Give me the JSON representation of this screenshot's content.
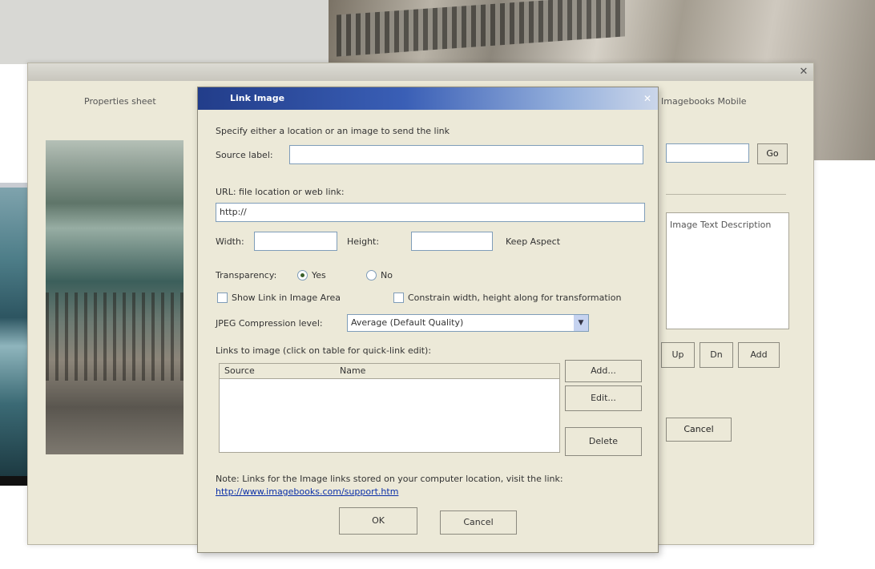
{
  "main_window": {
    "tabs": [
      "Properties sheet"
    ],
    "tab_right": "Imagebooks Mobile",
    "go_button": "Go",
    "list_item": "Image Text Description",
    "buttons": [
      "Up",
      "Dn",
      "Add"
    ],
    "cancel": "Cancel"
  },
  "dialog": {
    "title": "Link Image",
    "close_glyph": "✕",
    "instructions": "Specify either a location or an image to send the link",
    "source_label": "Source label:",
    "source_value": "",
    "url_section_label": "URL: file location or web link:",
    "url_value": "http://",
    "width_label": "Width:",
    "width_value": "",
    "height_label": "Height:",
    "height_value": "",
    "units_label": "Keep Aspect",
    "scale_label": "Transparency:",
    "scale_on": "Yes",
    "scale_off": "No",
    "check1": "Show Link in Image Area",
    "check2": "Constrain width, height along for transformation",
    "quality_label": "JPEG Compression level:",
    "quality_value": "Average (Default Quality)",
    "table_label": "Links to image (click on table for quick-link edit):",
    "table_headers": [
      "Source",
      "Name"
    ],
    "side_buttons": [
      "Add...",
      "Edit...",
      "Delete"
    ],
    "footer_text": "Note: Links for the Image links stored on your computer location, visit the link:",
    "footer_link": "http://www.imagebooks.com/support.htm",
    "ok": "OK",
    "cancel": "Cancel"
  },
  "colors": {
    "dialog_bg": "#ece9d8",
    "title_bar_start": "#223d8a",
    "title_bar_end": "#cbd6ea",
    "link": "#0a2fa8"
  }
}
